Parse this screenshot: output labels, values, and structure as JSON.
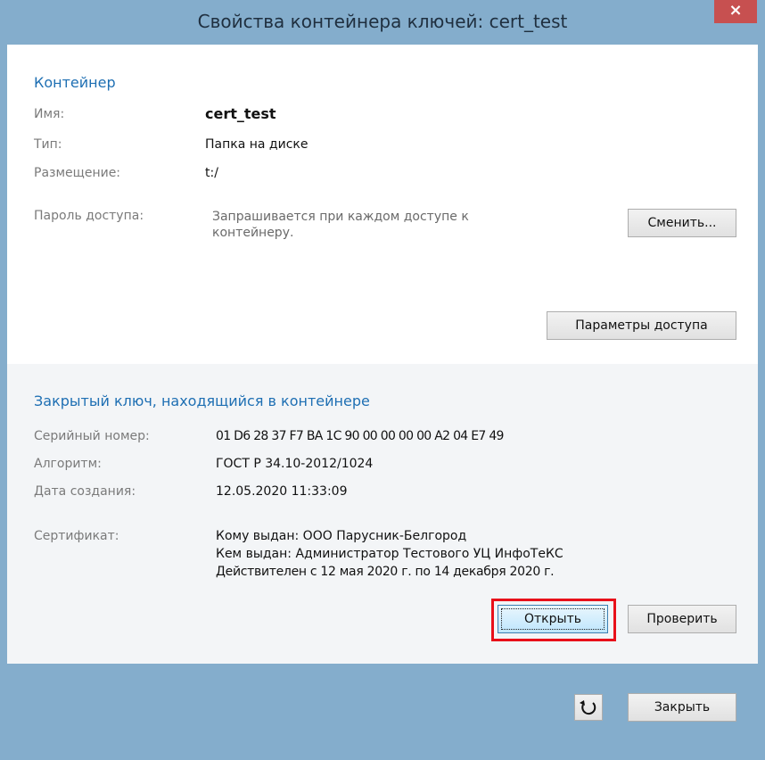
{
  "window": {
    "title": "Свойства контейнера ключей: cert_test",
    "close_glyph": "×"
  },
  "container": {
    "section_title": "Контейнер",
    "name_label": "Имя:",
    "name_value": "cert_test",
    "type_label": "Тип:",
    "type_value": "Папка на диске",
    "location_label": "Размещение:",
    "location_value": "t:/",
    "password_label": "Пароль доступа:",
    "password_value": "Запрашивается при каждом доступе к контейнеру.",
    "change_button": "Сменить...",
    "access_params_button": "Параметры доступа"
  },
  "private_key": {
    "section_title": "Закрытый ключ, находящийся в контейнере",
    "serial_label": "Серийный номер:",
    "serial_value": "01 D6 28 37 F7 BA 1C 90 00 00 00 00 A2 04 E7 49",
    "algorithm_label": "Алгоритм:",
    "algorithm_value": "ГОСТ Р 34.10-2012/1024",
    "created_label": "Дата создания:",
    "created_value": "12.05.2020 11:33:09",
    "certificate_label": "Сертификат:",
    "cert_issued_to": "Кому выдан: ООО Парусник-Белгород",
    "cert_issued_by": "Кем выдан: Администратор Тестового УЦ ИнфоТеКС",
    "cert_validity": "Действителен с 12 мая 2020 г. по 14 декабря 2020 г.",
    "open_button": "Открыть",
    "verify_button": "Проверить"
  },
  "footer": {
    "refresh_icon": "refresh-icon",
    "close_button": "Закрыть"
  },
  "colors": {
    "accent": "#1e6fb3",
    "frame": "#84adcc",
    "highlight": "#e8101a",
    "close_button": "#c75050"
  }
}
